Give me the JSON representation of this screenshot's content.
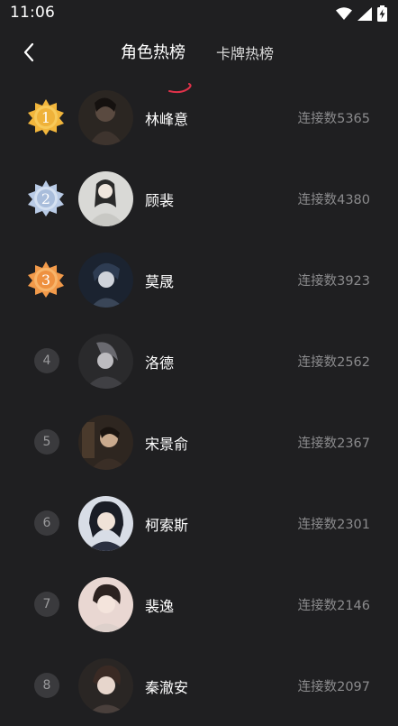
{
  "status_bar": {
    "time": "11:06",
    "icons": [
      "wifi-icon",
      "signal-icon",
      "battery-charging-icon"
    ]
  },
  "header": {
    "back_icon": "chevron-left-icon",
    "tabs": [
      {
        "label": "角色热榜",
        "active": true
      },
      {
        "label": "卡牌热榜",
        "active": false
      }
    ],
    "accent_color": "#e0324a"
  },
  "ranking": {
    "count_prefix": "连接数",
    "items": [
      {
        "rank": "1",
        "name": "林峰意",
        "count": "连接数5365",
        "medal": "gold"
      },
      {
        "rank": "2",
        "name": "顾裴",
        "count": "连接数4380",
        "medal": "silver"
      },
      {
        "rank": "3",
        "name": "莫晟",
        "count": "连接数3923",
        "medal": "bronze"
      },
      {
        "rank": "4",
        "name": "洛德",
        "count": "连接数2562"
      },
      {
        "rank": "5",
        "name": "宋景俞",
        "count": "连接数2367"
      },
      {
        "rank": "6",
        "name": "柯索斯",
        "count": "连接数2301"
      },
      {
        "rank": "7",
        "name": "裴逸",
        "count": "连接数2146"
      },
      {
        "rank": "8",
        "name": "秦澈安",
        "count": "连接数2097"
      }
    ]
  },
  "colors": {
    "background": "#1f1f21",
    "gold": "#f2b63c",
    "silver": "#b9cbe6",
    "bronze": "#f29a4a",
    "rank_circle": "#3a3a3d",
    "count_text": "#8b8b8d"
  }
}
